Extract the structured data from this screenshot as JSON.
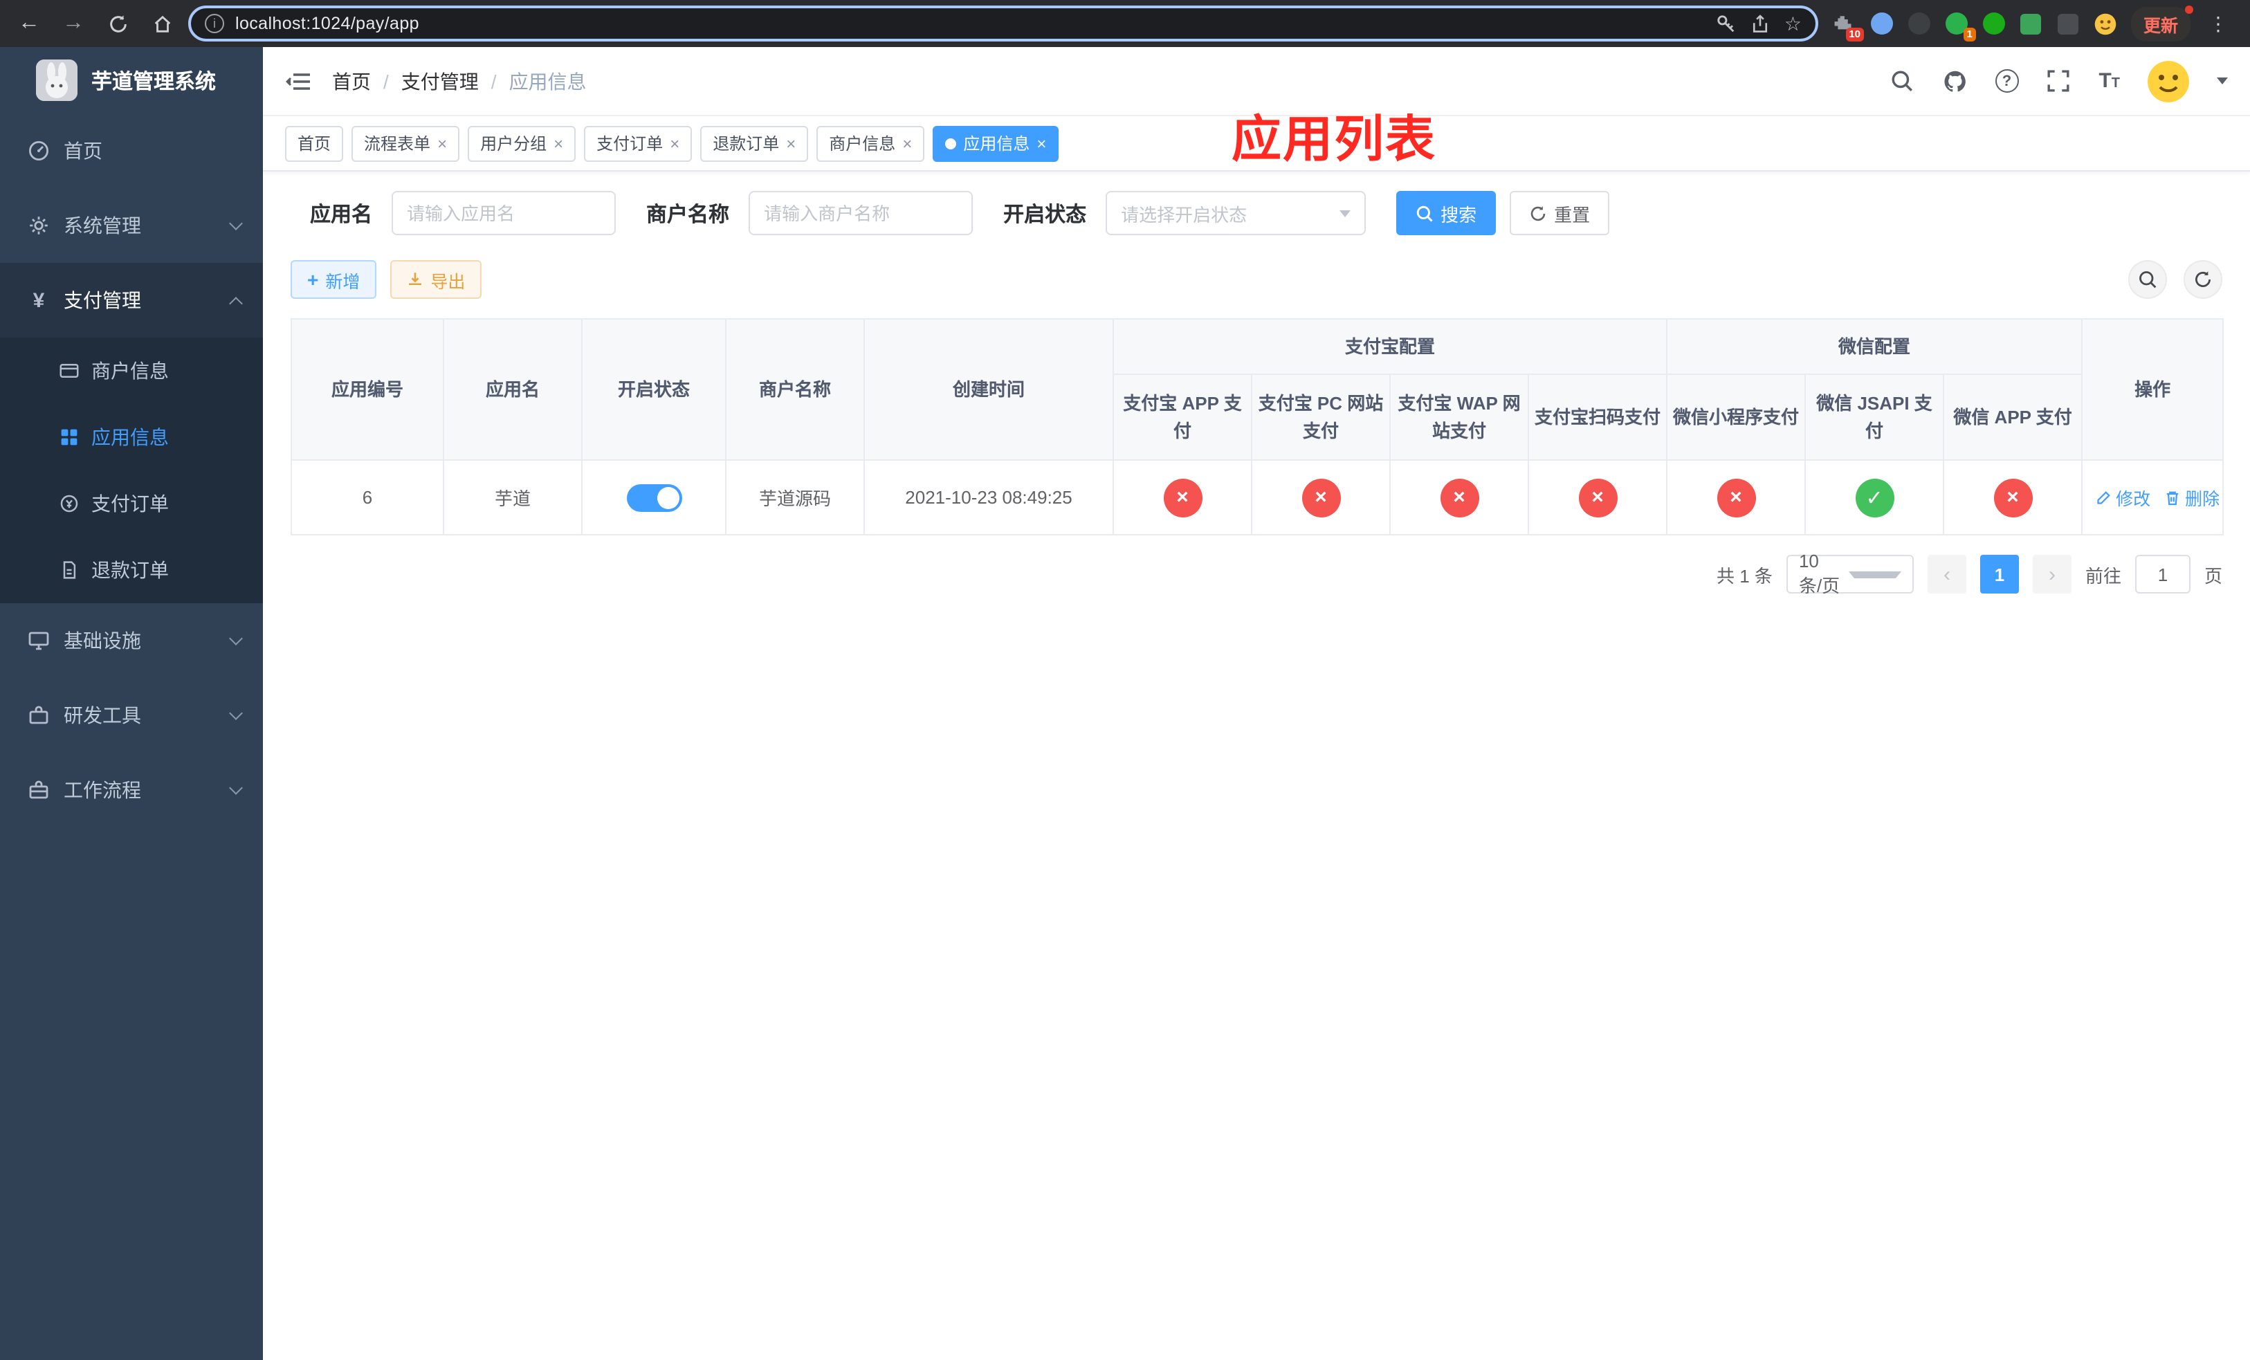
{
  "colors": {
    "accent": "#409eff",
    "success": "#43c15c",
    "danger": "#f5534f",
    "warning": "#e6a23c"
  },
  "browser": {
    "url": "localhost:1024/pay/app",
    "update_label": "更新",
    "ext_badge_a": "10",
    "ext_badge_b": "1"
  },
  "sidebar": {
    "title": "芋道管理系统",
    "items": [
      {
        "label": "首页"
      },
      {
        "label": "系统管理"
      },
      {
        "label": "支付管理"
      },
      {
        "label": "商户信息"
      },
      {
        "label": "应用信息"
      },
      {
        "label": "支付订单"
      },
      {
        "label": "退款订单"
      },
      {
        "label": "基础设施"
      },
      {
        "label": "研发工具"
      },
      {
        "label": "工作流程"
      }
    ]
  },
  "header": {
    "breadcrumb": [
      "首页",
      "支付管理",
      "应用信息"
    ],
    "breadcrumb_separator": "/",
    "overlay_title": "应用列表"
  },
  "tags": [
    {
      "label": "首页"
    },
    {
      "label": "流程表单"
    },
    {
      "label": "用户分组"
    },
    {
      "label": "支付订单"
    },
    {
      "label": "退款订单"
    },
    {
      "label": "商户信息"
    },
    {
      "label": "应用信息"
    }
  ],
  "filters": {
    "app_name_label": "应用名",
    "app_name_placeholder": "请输入应用名",
    "merchant_label": "商户名称",
    "merchant_placeholder": "请输入商户名称",
    "status_label": "开启状态",
    "status_placeholder": "请选择开启状态",
    "search_button": "搜索",
    "reset_button": "重置"
  },
  "toolbar": {
    "add_button": "新增",
    "export_button": "导出"
  },
  "table": {
    "columns": {
      "id": "应用编号",
      "name": "应用名",
      "status": "开启状态",
      "merchant": "商户名称",
      "created": "创建时间",
      "alipay_group": "支付宝配置",
      "wechat_group": "微信配置",
      "alipay_app": "支付宝 APP 支付",
      "alipay_pc": "支付宝 PC 网站支付",
      "alipay_wap": "支付宝 WAP 网站支付",
      "alipay_qr": "支付宝扫码支付",
      "wx_mini": "微信小程序支付",
      "wx_jsapi": "微信 JSAPI 支付",
      "wx_app": "微信 APP 支付",
      "ops": "操作"
    },
    "rows": [
      {
        "id": "6",
        "name": "芋道",
        "enabled": true,
        "merchant": "芋道源码",
        "created": "2021-10-23 08:49:25",
        "alipay_app": false,
        "alipay_pc": false,
        "alipay_wap": false,
        "alipay_qr": false,
        "wx_mini": false,
        "wx_jsapi": true,
        "wx_app": false,
        "edit": "修改",
        "delete": "删除"
      }
    ]
  },
  "pagination": {
    "total": "共 1 条",
    "page_size": "10条/页",
    "page": "1",
    "goto_label": "前往",
    "goto_value": "1",
    "goto_suffix": "页"
  }
}
